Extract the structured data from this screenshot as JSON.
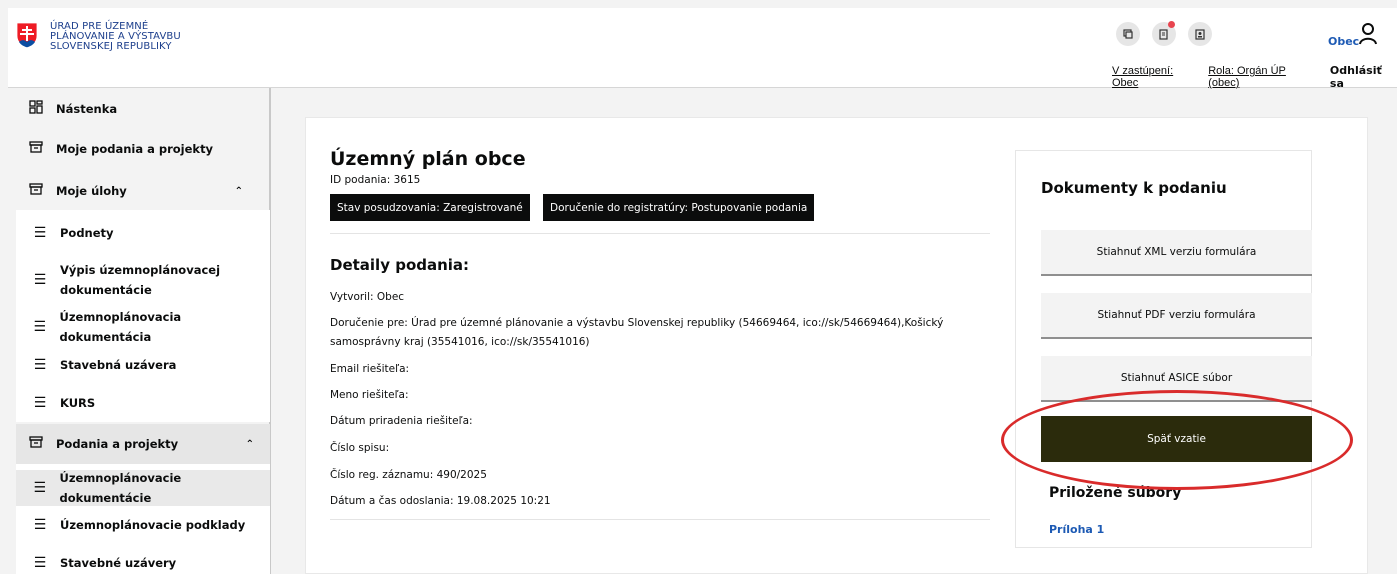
{
  "header": {
    "org_line1": "ÚRAD PRE ÚZEMNÉ",
    "org_line2": "PLÁNOVANIE A VÝSTAVBU",
    "org_line3": "SLOVENSKEJ REPUBLIKY",
    "icons": [
      "chat-icon",
      "document-notification-icon",
      "id-card-icon"
    ],
    "user_name": "Obec",
    "representation_link": "V zastúpení: Obec",
    "role_link": "Rola: Orgán ÚP (obec)",
    "logout_label": "Odhlásiť sa"
  },
  "sidebar": {
    "items": [
      {
        "label": "Nástenka",
        "icon": "dashboard-icon"
      },
      {
        "label": "Moje podania a projekty",
        "icon": "inbox-icon"
      },
      {
        "label": "Moje úlohy",
        "icon": "inbox-icon"
      }
    ],
    "tasks": [
      "Podnety",
      "Výpis územnoplánovacej dokumentácie",
      "Územnoplánovacia dokumentácia",
      "Stavebná uzávera",
      "KURS"
    ],
    "group_label": "Podania a projekty",
    "group_items": [
      "Územnoplánovacie dokumentácie",
      "Územnoplánovacie podklady",
      "Stavebné uzávery"
    ]
  },
  "main": {
    "title": "Územný plán obce",
    "id_line": "ID podania: 3615",
    "badge_status": "Stav posudzovania: Zaregistrované",
    "badge_delivery": "Doručenie do registratúry: Postupovanie podania",
    "details_title": "Detaily podania:",
    "created_by": "Vytvoril: Obec",
    "delivered_to_1": "Doručenie pre: Úrad pre územné plánovanie a výstavbu Slovenskej republiky (54669464, ico://sk/54669464),Košický",
    "delivered_to_2": "samosprávny kraj (35541016, ico://sk/35541016)",
    "email": "Email riešiteľa:",
    "name": "Meno riešiteľa:",
    "assign_date": "Dátum priradenia riešiteľa:",
    "file_number": "Číslo spisu:",
    "reg_number": "Číslo reg. záznamu: 490/2025",
    "sent_date": "Dátum a čas odoslania: 19.08.2025 10:21"
  },
  "documents": {
    "title": "Dokumenty k podaniu",
    "xml_button": "Stiahnuť XML verziu formulára",
    "pdf_button": "Stiahnuť PDF verziu formulára",
    "asice_button": "Stiahnuť ASICE súbor",
    "withdraw_button": "Späť vzatie",
    "attachments_title": "Priložené súbory",
    "attachment_1": "Príloha 1"
  },
  "colors": {
    "brand_blue": "#1d5ab4",
    "badge_black": "#0b0c0c",
    "withdraw_dark": "#2b2b0c",
    "annotation_red": "#d92b2b"
  }
}
